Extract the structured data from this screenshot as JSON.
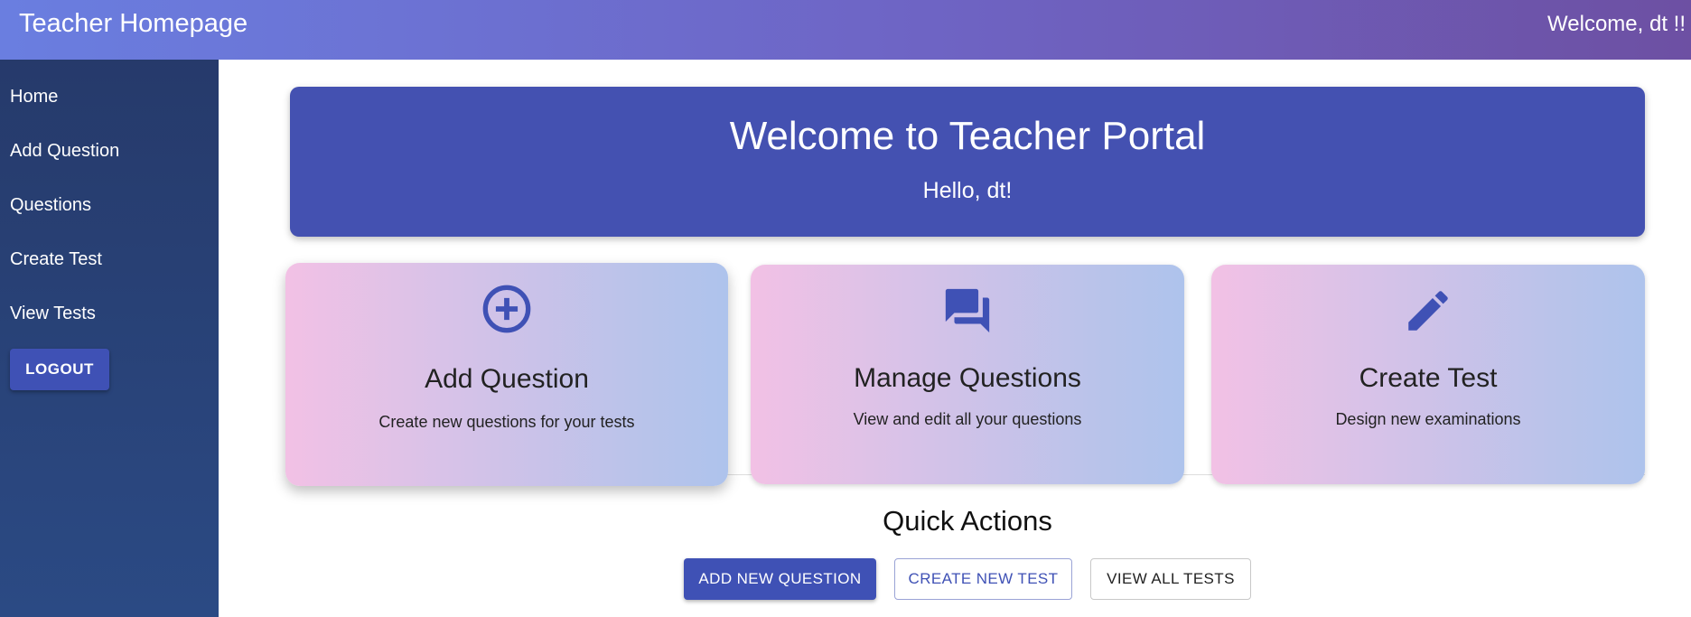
{
  "header": {
    "title": "Teacher Homepage",
    "welcome": "Welcome, dt !!"
  },
  "sidebar": {
    "items": [
      {
        "label": "Home"
      },
      {
        "label": "Add Question"
      },
      {
        "label": "Questions"
      },
      {
        "label": "Create Test"
      },
      {
        "label": "View Tests"
      }
    ],
    "logout_label": "LOGOUT"
  },
  "hero": {
    "title": "Welcome to Teacher Portal",
    "greeting": "Hello, dt!"
  },
  "cards": [
    {
      "icon": "add-circle-icon",
      "title": "Add Question",
      "description": "Create new questions for your tests"
    },
    {
      "icon": "chat-bubbles-icon",
      "title": "Manage Questions",
      "description": "View and edit all your questions"
    },
    {
      "icon": "pencil-icon",
      "title": "Create Test",
      "description": "Design new examinations"
    }
  ],
  "quick_actions": {
    "title": "Quick Actions",
    "buttons": [
      {
        "label": "ADD NEW QUESTION"
      },
      {
        "label": "CREATE NEW TEST"
      },
      {
        "label": "VIEW ALL TESTS"
      }
    ]
  },
  "colors": {
    "primary": "#3f51b5",
    "hero_bg": "#4451b1",
    "sidebar_bg": "#263a6b",
    "header_gradient_start": "#6a7ee0",
    "header_gradient_end": "#6d50a3",
    "card_gradient_start": "#f2c1e5",
    "card_gradient_end": "#aec3ec"
  }
}
